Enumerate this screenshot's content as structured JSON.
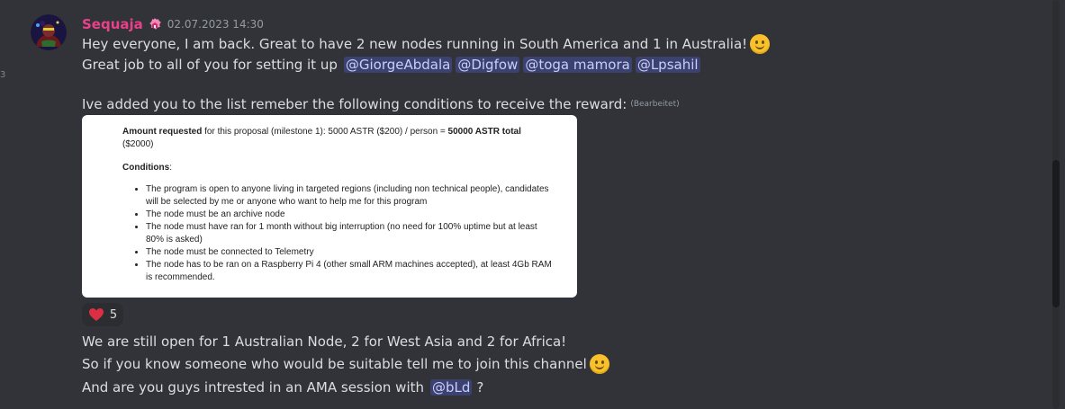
{
  "gutter": {
    "mark": "3"
  },
  "message": {
    "author": "Sequaja",
    "timestamp": "02.07.2023 14:30",
    "lines": {
      "l1": "Hey everyone, I am back. Great to have 2 new nodes running in South America and 1 in Australia!",
      "l2_prefix": "Great job to all of you for setting it up",
      "l3": "Ive added you to the list remeber the following conditions to receive the reward:",
      "edited": "(Bearbeitet)"
    },
    "mentions": [
      "@GiorgeAbdala",
      "@Digfow",
      "@toga mamora",
      "@Lpsahil"
    ],
    "attachment": {
      "amount_label": "Amount requested",
      "amount_text": " for this proposal (milestone 1): 5000 ASTR ($200) / person = ",
      "amount_total": "50000 ASTR total",
      "amount_tail": "($2000)",
      "conditions_label": "Conditions",
      "conditions_colon": ":",
      "items": [
        "The program is open to anyone living in targeted regions (including non technical people), candidates will be selected by me or anyone who want to help me for this program",
        "The node must be an archive node",
        "The node must have ran for 1 month without big interruption (no need for 100% uptime but at least 80% is asked)",
        "The node must be connected to Telemetry",
        "The node has to be ran on a Raspberry Pi 4 (other small ARM machines accepted), at least 4Gb RAM is recommended."
      ]
    },
    "reaction": {
      "emoji": "heart-icon",
      "count": "5"
    },
    "followup": {
      "f1": "We are still open for 1 Australian Node, 2 for West Asia and 2 for Africa!",
      "f2": "So if you know someone who would be suitable tell me to join this channel",
      "f3_prefix": "And are you guys intrested in an AMA session with",
      "f3_mention": "@bLd",
      "f3_suffix": "?"
    },
    "colors": {
      "background": "#313338",
      "username": "#e9408a",
      "mention_bg": "#3c4270",
      "mention_text": "#c9cdfb",
      "text": "#dbdee1",
      "muted": "#949ba4",
      "reaction_bg": "#2b2d31",
      "heart": "#dd2e44"
    }
  }
}
